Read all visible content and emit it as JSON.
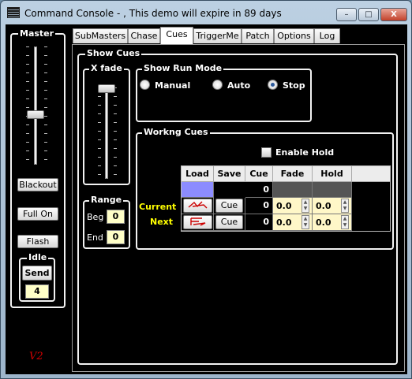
{
  "window": {
    "title": "Command Console - , This demo will expire in 89 days",
    "minimize": "–",
    "maximize": "□",
    "close": "X"
  },
  "master": {
    "label": "Master",
    "fader_level": 0.42,
    "blackout": "Blackout",
    "full_on": "Full On",
    "flash": "Flash",
    "idle_label": "Idle",
    "send": "Send",
    "idle_value": "4",
    "version": "V2"
  },
  "tabs": [
    {
      "label": "SubMasters",
      "active": false
    },
    {
      "label": "Chase",
      "active": false
    },
    {
      "label": "Cues",
      "active": true
    },
    {
      "label": "TriggerMe",
      "active": false
    },
    {
      "label": "Patch",
      "active": false
    },
    {
      "label": "Options",
      "active": false
    },
    {
      "label": "Log",
      "active": false
    }
  ],
  "show_cues": {
    "label": "Show Cues",
    "xfade": {
      "label": "X fade",
      "level": 1.0
    },
    "range": {
      "label": "Range",
      "beg_label": "Beg",
      "beg_value": "0",
      "end_label": "End",
      "end_value": "0"
    },
    "run_mode": {
      "label": "Show Run Mode",
      "options": [
        {
          "label": "Manual",
          "selected": false
        },
        {
          "label": "Auto",
          "selected": false
        },
        {
          "label": "Stop",
          "selected": true
        }
      ]
    },
    "working": {
      "label": "Workng Cues",
      "enable_hold": "Enable Hold",
      "columns": [
        "Load",
        "Save",
        "Cue",
        "Fade",
        "Hold"
      ],
      "rows": [
        {
          "label": "",
          "cue": "0",
          "fade": "",
          "hold": ""
        },
        {
          "label": "Current",
          "save": "Cue",
          "cue": "0",
          "fade": "0.0",
          "hold": "0.0"
        },
        {
          "label": "Next",
          "save": "Cue",
          "cue": "0",
          "fade": "0.0",
          "hold": "0.0"
        }
      ]
    }
  },
  "colors": {
    "accent_yellow": "#ffff00",
    "load_blue": "#8c8cff",
    "version_red": "#d40000"
  }
}
